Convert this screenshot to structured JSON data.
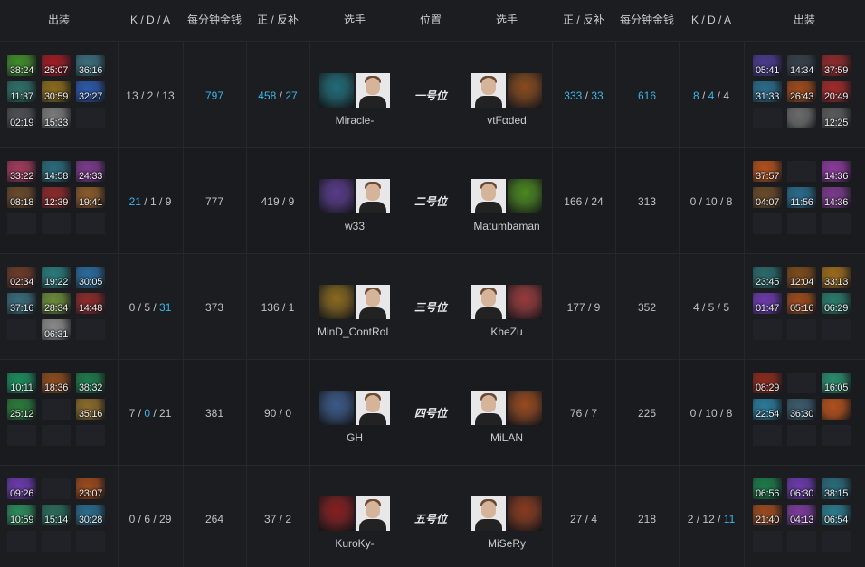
{
  "headers": {
    "left_items": "出装",
    "left_kda": "K / D / A",
    "left_gpm": "每分钟金钱",
    "left_lh": "正 / 反补",
    "left_player": "选手",
    "position": "位置",
    "right_player": "选手",
    "right_lh": "正 / 反补",
    "right_gpm": "每分钟金钱",
    "right_kda": "K / D / A",
    "right_items": "出装"
  },
  "accent_color": "#3ab6e8",
  "rows": [
    {
      "position": "一号位",
      "left": {
        "kda": {
          "k": "13",
          "d": "2",
          "a": "13",
          "hl": []
        },
        "gpm": "797",
        "gpm_hl": true,
        "lh": "458",
        "dn": "27",
        "lh_hl": true,
        "player": "Miracle-",
        "hero_color": "#1f6d78",
        "items": [
          {
            "t": "38:24",
            "c": "#3f8b2a"
          },
          {
            "t": "25:07",
            "c": "#9c1c24"
          },
          {
            "t": "36:16",
            "c": "#3b6c7a"
          },
          {
            "t": "11:37",
            "c": "#2e6e66"
          },
          {
            "t": "30:59",
            "c": "#8a6b1c"
          },
          {
            "t": "32:27",
            "c": "#2c58a8"
          },
          {
            "t": "02:19",
            "c": "#4d4f55"
          },
          {
            "t": "15:33",
            "c": "#7a7a7a"
          },
          {
            "t": "",
            "c": ""
          }
        ]
      },
      "right": {
        "kda": {
          "k": "8",
          "d": "4",
          "a": "4",
          "hl": [
            "k",
            "d"
          ]
        },
        "gpm": "616",
        "gpm_hl": true,
        "lh": "333",
        "dn": "33",
        "lh_hl": true,
        "player": "vtFαded",
        "hero_color": "#8a4a1c",
        "items": [
          {
            "t": "05:41",
            "c": "#4a3a8c"
          },
          {
            "t": "14:34",
            "c": "#36404a"
          },
          {
            "t": "37:59",
            "c": "#8c2a2a"
          },
          {
            "t": "31:33",
            "c": "#2a6c8a"
          },
          {
            "t": "26:43",
            "c": "#9c4a1c"
          },
          {
            "t": "20:49",
            "c": "#a02a2a"
          },
          {
            "t": "",
            "c": ""
          },
          {
            "t": "",
            "c": "#6a6a6a"
          },
          {
            "t": "12:25",
            "c": "#5a5a5a"
          }
        ]
      }
    },
    {
      "position": "二号位",
      "left": {
        "kda": {
          "k": "21",
          "d": "1",
          "a": "9",
          "hl": [
            "k"
          ]
        },
        "gpm": "777",
        "gpm_hl": false,
        "lh": "419",
        "dn": "9",
        "lh_hl": false,
        "player": "w33",
        "hero_color": "#5a3a8c",
        "items": [
          {
            "t": "33:22",
            "c": "#a03a5a"
          },
          {
            "t": "14:58",
            "c": "#2a6a7a"
          },
          {
            "t": "24:33",
            "c": "#7a3a8a"
          },
          {
            "t": "08:18",
            "c": "#6a4a2a"
          },
          {
            "t": "12:39",
            "c": "#8a2a2a"
          },
          {
            "t": "19:41",
            "c": "#8a5a2a"
          },
          {
            "t": "",
            "c": ""
          },
          {
            "t": "",
            "c": ""
          },
          {
            "t": "",
            "c": ""
          }
        ]
      },
      "right": {
        "kda": {
          "k": "0",
          "d": "10",
          "a": "8",
          "hl": []
        },
        "gpm": "313",
        "gpm_hl": false,
        "lh": "166",
        "dn": "24",
        "lh_hl": false,
        "player": "Matumbaman",
        "hero_color": "#4a8a1c",
        "items": [
          {
            "t": "37:57",
            "c": "#b0501c"
          },
          {
            "t": "",
            "c": ""
          },
          {
            "t": "14:36",
            "c": "#8a3a9a"
          },
          {
            "t": "04:07",
            "c": "#6a4a2a"
          },
          {
            "t": "11:56",
            "c": "#2a6a8a"
          },
          {
            "t": "14:36",
            "c": "#7a3a8a"
          },
          {
            "t": "",
            "c": ""
          },
          {
            "t": "",
            "c": ""
          },
          {
            "t": "",
            "c": ""
          }
        ]
      }
    },
    {
      "position": "三号位",
      "left": {
        "kda": {
          "k": "0",
          "d": "5",
          "a": "31",
          "hl": [
            "a"
          ]
        },
        "gpm": "373",
        "gpm_hl": false,
        "lh": "136",
        "dn": "1",
        "lh_hl": false,
        "player": "MinD_ContRoL",
        "hero_color": "#8a6a1c",
        "items": [
          {
            "t": "02:34",
            "c": "#6a3a2a"
          },
          {
            "t": "19:22",
            "c": "#2a7a7a"
          },
          {
            "t": "30:05",
            "c": "#2a6a9a"
          },
          {
            "t": "37:16",
            "c": "#3a6a7a"
          },
          {
            "t": "28:34",
            "c": "#6a8a3a"
          },
          {
            "t": "14:48",
            "c": "#8a2a2a"
          },
          {
            "t": "",
            "c": ""
          },
          {
            "t": "06:31",
            "c": "#8a8a8a"
          },
          {
            "t": "",
            "c": ""
          }
        ]
      },
      "right": {
        "kda": {
          "k": "4",
          "d": "5",
          "a": "5",
          "hl": []
        },
        "gpm": "352",
        "gpm_hl": false,
        "lh": "177",
        "dn": "9",
        "lh_hl": false,
        "player": "KheZu",
        "hero_color": "#9a3a3a",
        "items": [
          {
            "t": "23:45",
            "c": "#2a6a6a"
          },
          {
            "t": "12:04",
            "c": "#7a4a1c"
          },
          {
            "t": "33:13",
            "c": "#9a6a1c"
          },
          {
            "t": "01:47",
            "c": "#6a3aaa"
          },
          {
            "t": "05:16",
            "c": "#9a4a1c"
          },
          {
            "t": "06:29",
            "c": "#2a7a6a"
          },
          {
            "t": "",
            "c": ""
          },
          {
            "t": "",
            "c": ""
          },
          {
            "t": "",
            "c": ""
          }
        ]
      }
    },
    {
      "position": "四号位",
      "left": {
        "kda": {
          "k": "7",
          "d": "0",
          "a": "21",
          "hl": [
            "d"
          ]
        },
        "gpm": "381",
        "gpm_hl": false,
        "lh": "90",
        "dn": "0",
        "lh_hl": false,
        "player": "GH",
        "hero_color": "#3a5a8a",
        "items": [
          {
            "t": "10:11",
            "c": "#1c8a5a"
          },
          {
            "t": "18:36",
            "c": "#8a4a1c"
          },
          {
            "t": "38:32",
            "c": "#1c7a4a"
          },
          {
            "t": "25:12",
            "c": "#2a7a3a"
          },
          {
            "t": "",
            "c": ""
          },
          {
            "t": "35:16",
            "c": "#8a6a2a"
          },
          {
            "t": "",
            "c": ""
          },
          {
            "t": "",
            "c": ""
          },
          {
            "t": "",
            "c": ""
          }
        ]
      },
      "right": {
        "kda": {
          "k": "0",
          "d": "10",
          "a": "8",
          "hl": []
        },
        "gpm": "225",
        "gpm_hl": false,
        "lh": "76",
        "dn": "7",
        "lh_hl": false,
        "player": "MiLAN",
        "hero_color": "#9a4a1c",
        "items": [
          {
            "t": "08:29",
            "c": "#8a2a1c"
          },
          {
            "t": "",
            "c": ""
          },
          {
            "t": "16:05",
            "c": "#2a8a6a"
          },
          {
            "t": "22:54",
            "c": "#2a7a9a"
          },
          {
            "t": "36:30",
            "c": "#3a5a6a"
          },
          {
            "t": "",
            "c": "#b0501c"
          },
          {
            "t": "",
            "c": ""
          },
          {
            "t": "",
            "c": ""
          },
          {
            "t": "",
            "c": ""
          }
        ]
      }
    },
    {
      "position": "五号位",
      "left": {
        "kda": {
          "k": "0",
          "d": "6",
          "a": "29",
          "hl": []
        },
        "gpm": "264",
        "gpm_hl": false,
        "lh": "37",
        "dn": "2",
        "lh_hl": false,
        "player": "KuroKy-",
        "hero_color": "#8a1c1c",
        "items": [
          {
            "t": "09:26",
            "c": "#6a3aaa"
          },
          {
            "t": "",
            "c": ""
          },
          {
            "t": "23:07",
            "c": "#9a4a1c"
          },
          {
            "t": "10:59",
            "c": "#2a8a5a"
          },
          {
            "t": "15:14",
            "c": "#2a6a5a"
          },
          {
            "t": "30:28",
            "c": "#2a6a8a"
          },
          {
            "t": "",
            "c": ""
          },
          {
            "t": "",
            "c": ""
          },
          {
            "t": "",
            "c": ""
          }
        ]
      },
      "right": {
        "kda": {
          "k": "2",
          "d": "12",
          "a": "11",
          "hl": [
            "a"
          ]
        },
        "gpm": "218",
        "gpm_hl": false,
        "lh": "27",
        "dn": "4",
        "lh_hl": false,
        "player": "MiSeRy",
        "hero_color": "#8a3a1c",
        "items": [
          {
            "t": "06:56",
            "c": "#1c7a4a"
          },
          {
            "t": "06:30",
            "c": "#6a3aaa"
          },
          {
            "t": "38:15",
            "c": "#2a6a7a"
          },
          {
            "t": "21:40",
            "c": "#9a4a1c"
          },
          {
            "t": "04:13",
            "c": "#7a3a9a"
          },
          {
            "t": "06:54",
            "c": "#2a7a8a"
          },
          {
            "t": "",
            "c": ""
          },
          {
            "t": "",
            "c": ""
          },
          {
            "t": "",
            "c": ""
          }
        ]
      }
    }
  ]
}
